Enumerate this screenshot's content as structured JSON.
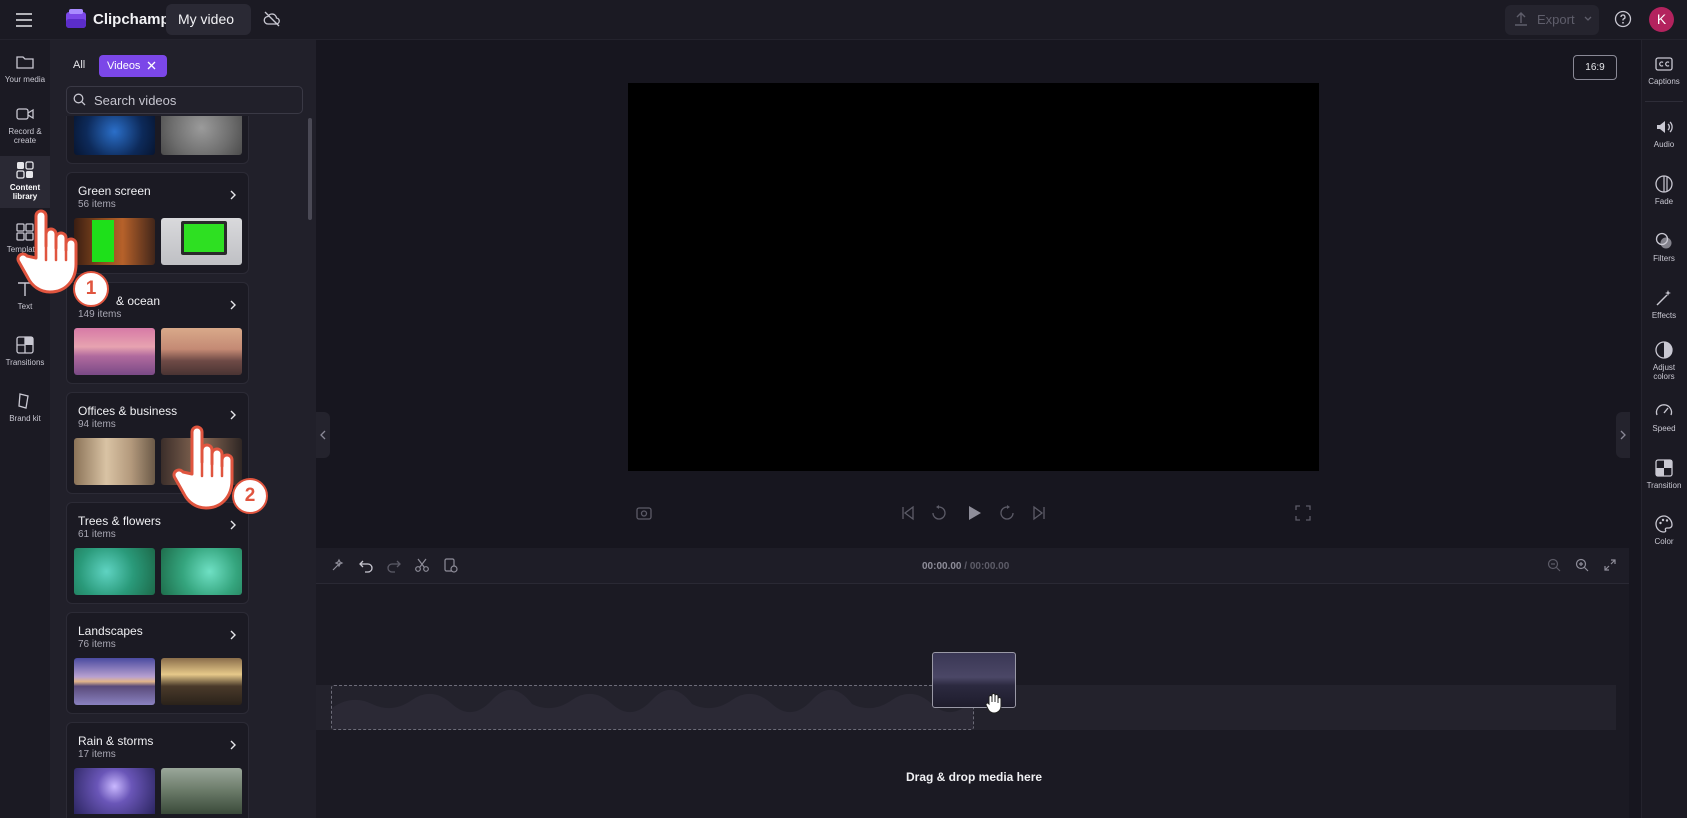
{
  "app": {
    "name": "Clipchamp",
    "project_title": "My video",
    "export_label": "Export",
    "avatar_initial": "K"
  },
  "left_rail": [
    {
      "label": "Your media",
      "icon": "folder-icon"
    },
    {
      "label": "Record & create",
      "icon": "camera-icon"
    },
    {
      "label": "Content library",
      "icon": "content-library-icon",
      "active": true
    },
    {
      "label": "Templates",
      "icon": "templates-icon"
    },
    {
      "label": "Text",
      "icon": "text-icon"
    },
    {
      "label": "Transitions",
      "icon": "transitions-icon"
    },
    {
      "label": "Brand kit",
      "icon": "brand-kit-icon"
    }
  ],
  "library": {
    "filter_all": "All",
    "filter_active": "Videos",
    "search_placeholder": "Search videos",
    "categories": [
      {
        "title": "Green screen",
        "count": "56 items"
      },
      {
        "title": "& ocean",
        "count": "149 items"
      },
      {
        "title": "Offices & business",
        "count": "94 items"
      },
      {
        "title": "Trees & flowers",
        "count": "61 items"
      },
      {
        "title": "Landscapes",
        "count": "76 items"
      },
      {
        "title": "Rain & storms",
        "count": "17 items"
      }
    ]
  },
  "preview": {
    "aspect_ratio": "16:9"
  },
  "timeline": {
    "current_time": "00:00.00",
    "total_time": "/ 00:00.00",
    "drop_hint": "Drag & drop media here"
  },
  "right_rail": [
    {
      "label": "Captions",
      "icon": "captions-icon"
    },
    {
      "label": "Audio",
      "icon": "audio-icon"
    },
    {
      "label": "Fade",
      "icon": "fade-icon"
    },
    {
      "label": "Filters",
      "icon": "filters-icon"
    },
    {
      "label": "Effects",
      "icon": "effects-icon"
    },
    {
      "label": "Adjust colors",
      "icon": "adjust-colors-icon"
    },
    {
      "label": "Speed",
      "icon": "speed-icon"
    },
    {
      "label": "Transition",
      "icon": "transition-icon"
    },
    {
      "label": "Color",
      "icon": "color-icon"
    }
  ],
  "annotations": {
    "step1": "1",
    "step2": "2"
  },
  "colors": {
    "accent": "#7b47e8",
    "annotation": "#e0553f",
    "avatar": "#b3235e"
  }
}
